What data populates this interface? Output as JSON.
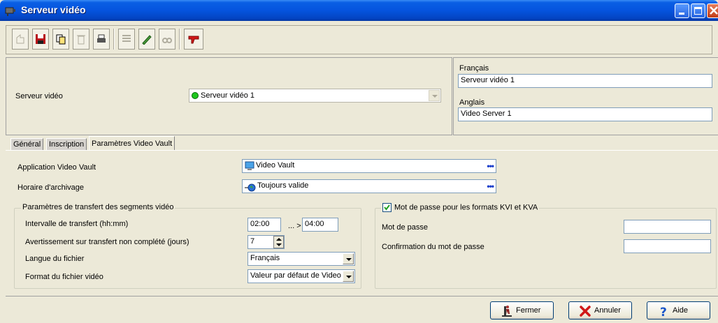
{
  "window": {
    "title": "Serveur vidéo",
    "accent": "#0554de"
  },
  "toolbar": {
    "buttons": [
      "new-icon",
      "save-icon",
      "copy-icon",
      "delete-icon",
      "print-icon",
      "list-icon",
      "edit-icon",
      "search-icon",
      "pin-icon"
    ]
  },
  "header": {
    "server_label": "Serveur vidéo",
    "server_value": "Serveur vidéo 1",
    "status_color": "#1ec61e",
    "french_label": "Français",
    "french_value": "Serveur vidéo 1",
    "english_label": "Anglais",
    "english_value": "Video Server 1"
  },
  "tabs": [
    {
      "label": "Général",
      "active": false
    },
    {
      "label": "Inscription",
      "active": false
    },
    {
      "label": "Paramètres Video Vault",
      "active": true
    }
  ],
  "vault": {
    "app_label": "Application Video Vault",
    "app_value": "Video Vault",
    "schedule_label": "Horaire d'archivage",
    "schedule_value": "Toujours valide",
    "more": "•••"
  },
  "transfer": {
    "legend": "Paramètres de transfert des segments vidéo",
    "interval_label": "Intervalle de transfert (hh:mm)",
    "interval_from": "02:00",
    "interval_sep": "... >",
    "interval_to": "04:00",
    "warning_label": "Avertissement sur transfert non complété (jours)",
    "warning_value": "7",
    "language_label": "Langue du fichier",
    "language_value": "Français",
    "format_label": "Format du fichier vidéo",
    "format_value": "Valeur par défaut de Video"
  },
  "password": {
    "checkbox_label": "Mot de passe pour les formats KVI et KVA",
    "checked": true,
    "password_label": "Mot de passe",
    "confirm_label": "Confirmation du mot de passe"
  },
  "footer": {
    "close_label": "Fermer",
    "cancel_label": "Annuler",
    "help_label": "Aide"
  }
}
